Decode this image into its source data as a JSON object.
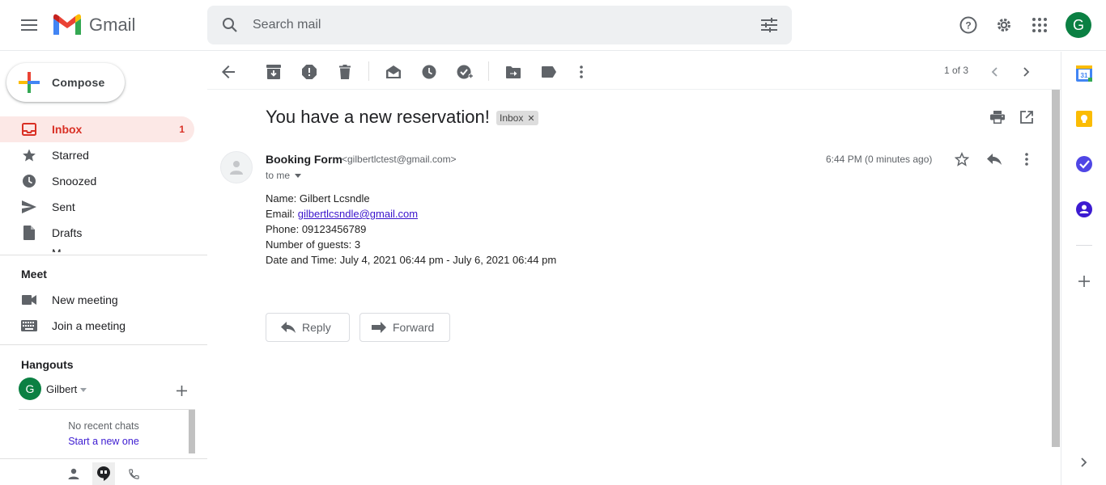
{
  "app": {
    "name": "Gmail"
  },
  "search": {
    "placeholder": "Search mail"
  },
  "account": {
    "avatar_letter": "G",
    "avatar_color": "#0b8043"
  },
  "compose": {
    "label": "Compose"
  },
  "nav": {
    "items": [
      {
        "label": "Inbox",
        "count": "1",
        "icon": "inbox-icon"
      },
      {
        "label": "Starred",
        "count": "",
        "icon": "star-icon"
      },
      {
        "label": "Snoozed",
        "count": "",
        "icon": "clock-icon"
      },
      {
        "label": "Sent",
        "count": "",
        "icon": "send-icon"
      },
      {
        "label": "Drafts",
        "count": "",
        "icon": "draft-icon"
      }
    ]
  },
  "meet": {
    "title": "Meet",
    "new_meeting": "New meeting",
    "join_meeting": "Join a meeting"
  },
  "hangouts": {
    "title": "Hangouts",
    "user_name": "Gilbert",
    "user_letter": "G",
    "no_chats": "No recent chats",
    "start_new": "Start a new one"
  },
  "toolbar": {
    "pager": "1 of 3"
  },
  "message": {
    "subject": "You have a new reservation!",
    "label": "Inbox",
    "sender_name": "Booking Form",
    "sender_email": "<gilbertlctest@gmail.com>",
    "to": "to me",
    "timestamp": "6:44 PM (0 minutes ago)",
    "body": {
      "name": "Name: Gilbert Lcsndle",
      "email_prefix": "Email: ",
      "email_link": "gilbertlcsndle@gmail.com",
      "phone": "Phone: 09123456789",
      "guests": "Number of guests: 3",
      "datetime": "Date and Time: July 4, 2021 06:44 pm - July 6, 2021 06:44 pm"
    },
    "reply_label": "Reply",
    "forward_label": "Forward"
  },
  "colors": {
    "accent_red": "#d93025",
    "active_bg": "#fce8e6",
    "link": "#3a14cc"
  }
}
